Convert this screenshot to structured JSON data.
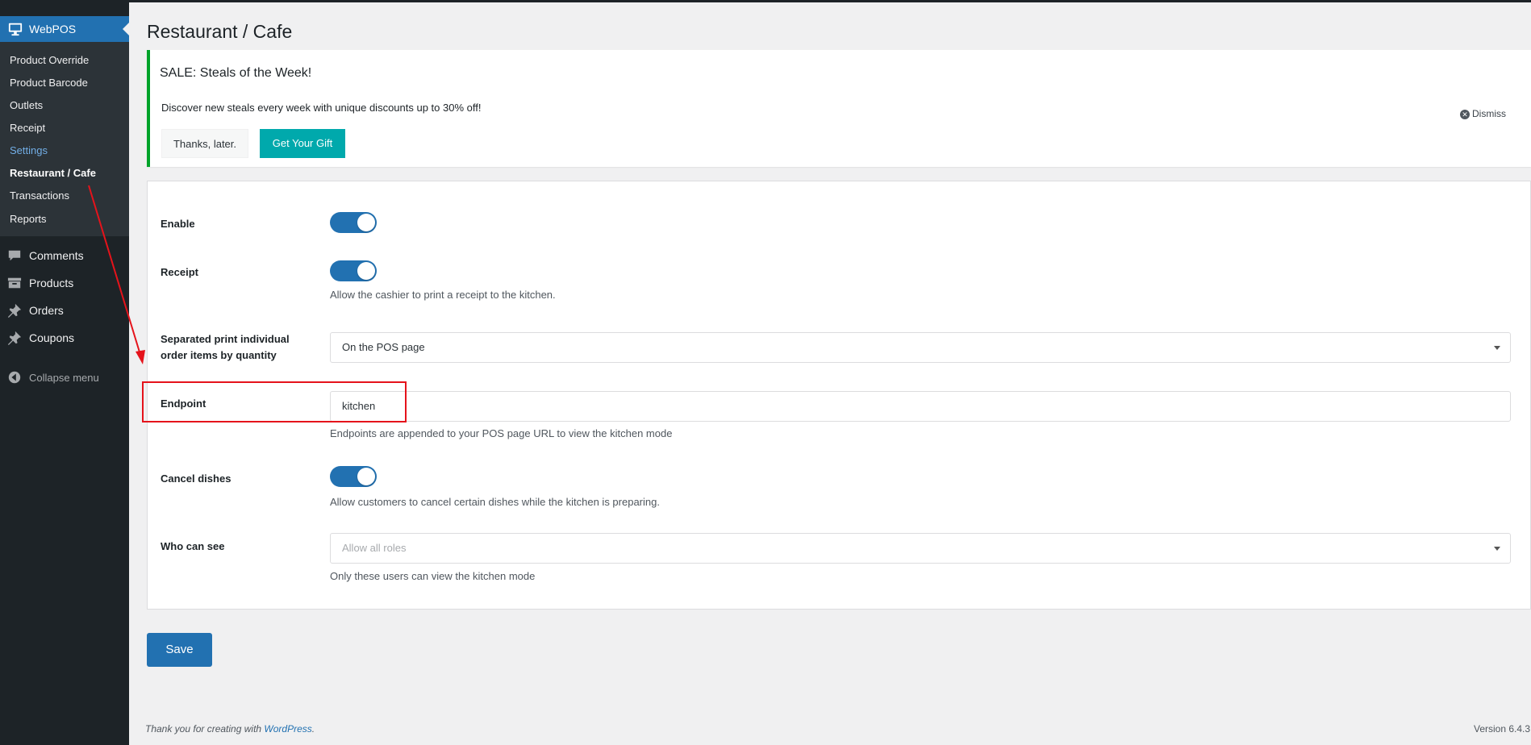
{
  "sidebar": {
    "header_label": "WebPOS",
    "submenu": [
      {
        "label": "Product Override"
      },
      {
        "label": "Product Barcode"
      },
      {
        "label": "Outlets"
      },
      {
        "label": "Receipt"
      },
      {
        "label": "Settings"
      },
      {
        "label": "Restaurant / Cafe"
      },
      {
        "label": "Transactions"
      },
      {
        "label": "Reports"
      }
    ],
    "menu": [
      {
        "label": "Comments",
        "icon": "comments-icon"
      },
      {
        "label": "Products",
        "icon": "products-icon"
      },
      {
        "label": "Orders",
        "icon": "pin-icon"
      },
      {
        "label": "Coupons",
        "icon": "pin-icon"
      }
    ],
    "collapse_label": "Collapse menu"
  },
  "page": {
    "title": "Restaurant / Cafe"
  },
  "notice": {
    "title": "SALE: Steals of the Week!",
    "text": "Discover new steals every week with unique discounts up to 30% off!",
    "later_label": "Thanks, later.",
    "gift_label": "Get Your Gift",
    "dismiss_label": "Dismiss"
  },
  "settings": {
    "enable": {
      "label": "Enable"
    },
    "receipt": {
      "label": "Receipt",
      "desc": "Allow the cashier to print a receipt to the kitchen."
    },
    "separated": {
      "label_line1": "Separated print individual",
      "label_line2": "order items by quantity",
      "value": "On the POS page"
    },
    "endpoint": {
      "label": "Endpoint",
      "value": "kitchen",
      "desc": "Endpoints are appended to your POS page URL to view the kitchen mode"
    },
    "cancel": {
      "label": "Cancel dishes",
      "desc": "Allow customers to cancel certain dishes while the kitchen is preparing."
    },
    "who": {
      "label": "Who can see",
      "placeholder": "Allow all roles",
      "desc": "Only these users can view the kitchen mode"
    }
  },
  "save_label": "Save",
  "footer": {
    "thanks_prefix": "Thank you for creating with ",
    "thanks_link": "WordPress",
    "thanks_suffix": ".",
    "version": "Version 6.4.3"
  },
  "colors": {
    "accent": "#2271b1",
    "highlight": "#e5131b",
    "notice_border": "#00a32a",
    "gift_button": "#00a9ac"
  }
}
